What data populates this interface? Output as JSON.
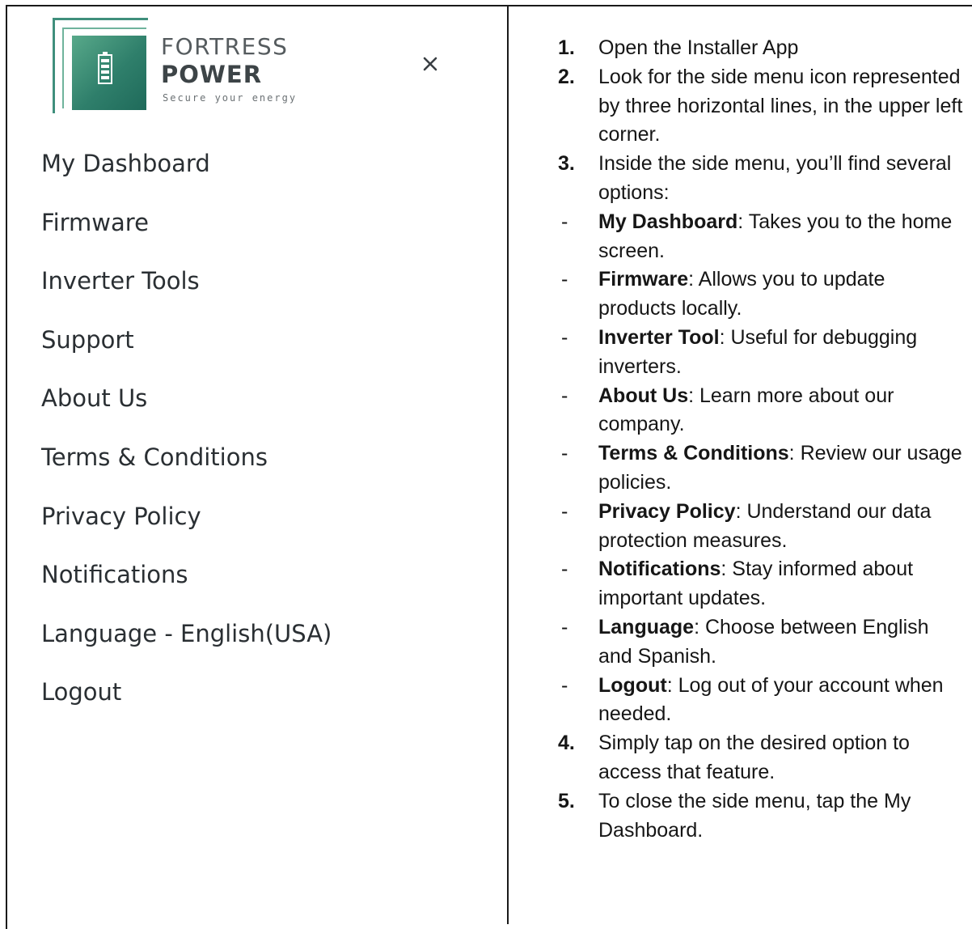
{
  "app": {
    "logo": {
      "brand_top": "FORTRESS",
      "brand_bottom": "POWER",
      "tagline": "Secure your energy",
      "icon": "battery-icon",
      "colors": {
        "frame_outer": "#3f8f7c",
        "frame_inner": "#6fb39c",
        "square_dark": "#1f6a5a",
        "square_light": "#58a98a"
      }
    },
    "close_icon": "close-icon",
    "menu": {
      "items": [
        {
          "label": "My Dashboard"
        },
        {
          "label": "Firmware"
        },
        {
          "label": "Inverter Tools"
        },
        {
          "label": "Support"
        },
        {
          "label": "About Us"
        },
        {
          "label": "Terms & Conditions"
        },
        {
          "label": "Privacy Policy"
        },
        {
          "label": "Notifications"
        },
        {
          "label": "Language - English(USA)"
        },
        {
          "label": "Logout"
        }
      ]
    }
  },
  "instructions": {
    "steps": [
      {
        "marker": "1.",
        "text": "Open the Installer App"
      },
      {
        "marker": "2.",
        "text": "Look for the side menu icon represented by three horizontal lines, in the upper left corner."
      },
      {
        "marker": "3.",
        "text": "Inside the side menu, you’ll find several options:"
      },
      {
        "marker": "-",
        "term": "My Dashboard",
        "text": ": Takes you to the home screen."
      },
      {
        "marker": "-",
        "term": "Firmware",
        "text": ": Allows you to update products locally."
      },
      {
        "marker": "-",
        "term": "Inverter Tool",
        "text": ": Useful for debugging inverters."
      },
      {
        "marker": "-",
        "term": "About Us",
        "text": ": Learn more about our company."
      },
      {
        "marker": "-",
        "term": "Terms & Conditions",
        "text": ": Review our usage policies."
      },
      {
        "marker": "-",
        "term": "Privacy Policy",
        "text": ": Understand our data protection measures."
      },
      {
        "marker": "-",
        "term": "Notifications",
        "text": ": Stay informed about important updates."
      },
      {
        "marker": "-",
        "term": "Language",
        "text": ": Choose between English and Spanish."
      },
      {
        "marker": "-",
        "term": "Logout",
        "text": ": Log out of your account when needed."
      },
      {
        "marker": "4.",
        "text": "Simply tap on the desired option to access that feature."
      },
      {
        "marker": "5.",
        "text": "To close the side menu, tap the My Dashboard."
      }
    ]
  }
}
